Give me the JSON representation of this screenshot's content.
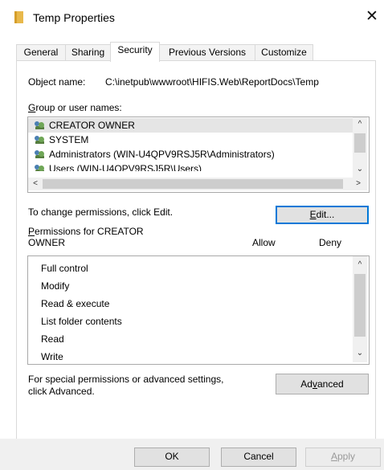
{
  "window": {
    "title": "Temp Properties",
    "close_icon": "close-icon"
  },
  "tabs": [
    {
      "label": "General"
    },
    {
      "label": "Sharing"
    },
    {
      "label": "Security"
    },
    {
      "label": "Previous Versions"
    },
    {
      "label": "Customize"
    }
  ],
  "security": {
    "object_name_label": "Object name:",
    "object_name_value": "C:\\inetpub\\wwwroot\\HIFIS.Web\\ReportDocs\\Temp",
    "group_label": "Group or user names:",
    "users": [
      {
        "name": "CREATOR OWNER",
        "icon": "users-group-icon"
      },
      {
        "name": "SYSTEM",
        "icon": "users-group-icon"
      },
      {
        "name": "Administrators (WIN-U4QPV9RSJ5R\\Administrators)",
        "icon": "users-group-icon"
      },
      {
        "name": "Users (WIN-U4QPV9RSJ5R\\Users)",
        "icon": "users-group-icon"
      }
    ],
    "change_text": "To change permissions, click Edit.",
    "edit_button": "Edit...",
    "permissions_for": "Permissions for CREATOR",
    "permissions_for_line2": "OWNER",
    "allow_header": "Allow",
    "deny_header": "Deny",
    "permissions": [
      {
        "name": "Full control"
      },
      {
        "name": "Modify"
      },
      {
        "name": "Read & execute"
      },
      {
        "name": "List folder contents"
      },
      {
        "name": "Read"
      },
      {
        "name": "Write"
      }
    ],
    "special_text_line1": "For special permissions or advanced settings,",
    "special_text_line2": "click Advanced.",
    "advanced_button": "Advanced"
  },
  "footer": {
    "ok": "OK",
    "cancel": "Cancel",
    "apply": "Apply"
  }
}
